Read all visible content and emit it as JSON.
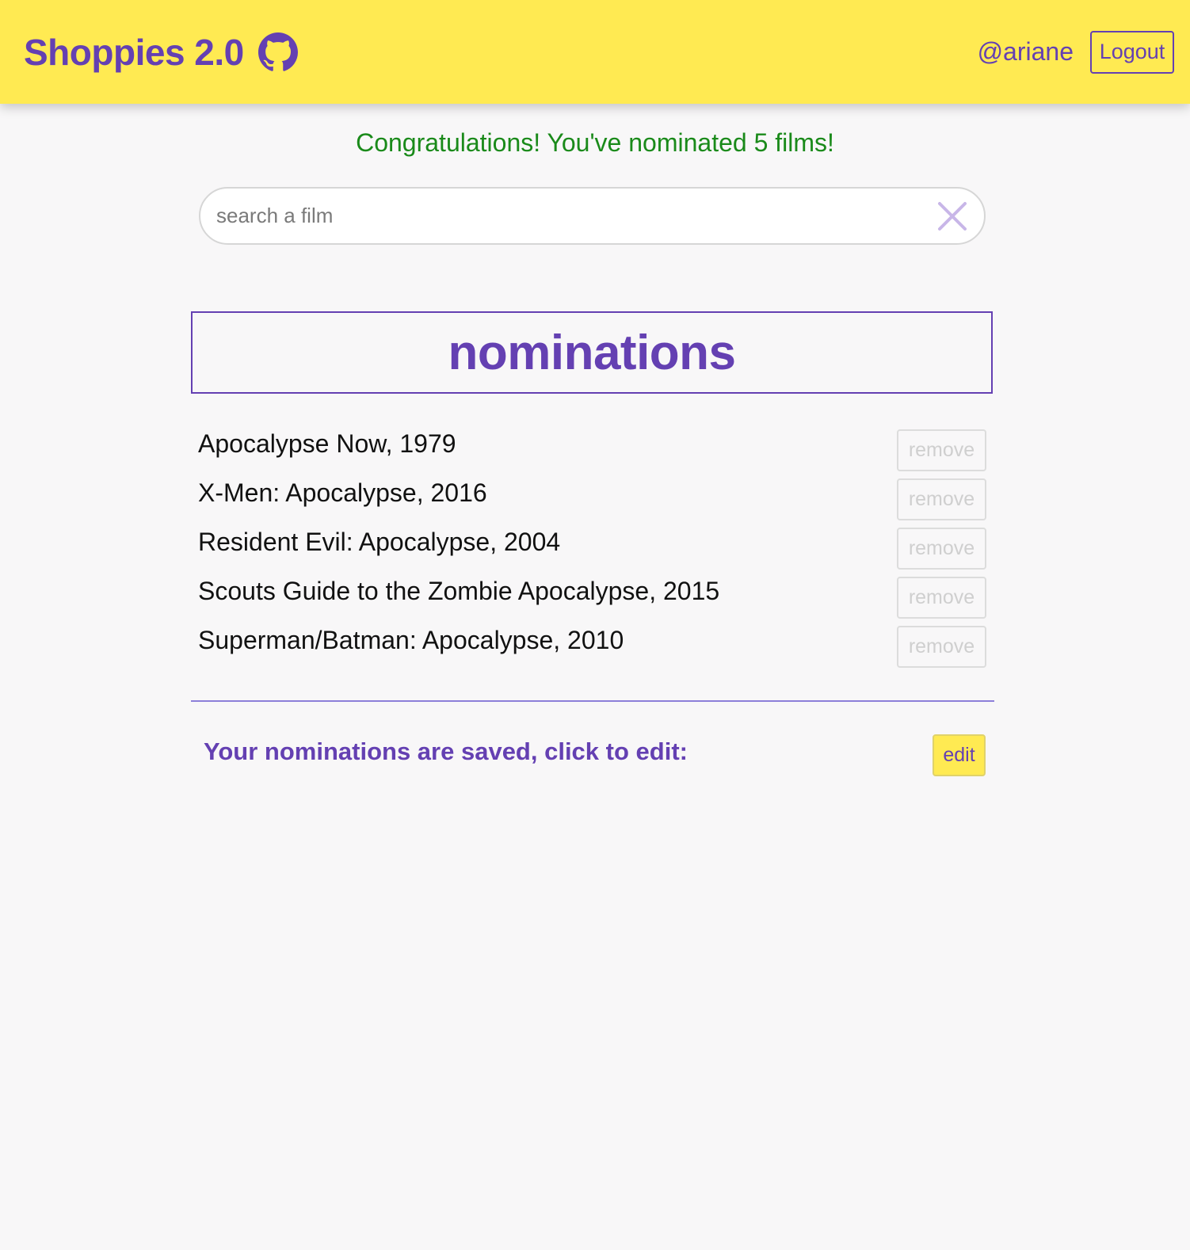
{
  "header": {
    "title": "Shoppies 2.0",
    "github_icon": "github-icon",
    "username": "@ariane",
    "logout_label": "Logout"
  },
  "banner": {
    "message": "Congratulations! You've nominated 5 films!"
  },
  "search": {
    "placeholder": "search a film",
    "value": "",
    "clear_icon": "close-icon"
  },
  "nominations": {
    "title": "nominations",
    "items": [
      {
        "title": "Apocalypse Now, 1979",
        "remove_label": "remove"
      },
      {
        "title": "X-Men: Apocalypse, 2016",
        "remove_label": "remove"
      },
      {
        "title": "Resident Evil: Apocalypse, 2004",
        "remove_label": "remove"
      },
      {
        "title": "Scouts Guide to the Zombie Apocalypse, 2015",
        "remove_label": "remove"
      },
      {
        "title": "Superman/Batman: Apocalypse, 2010",
        "remove_label": "remove"
      }
    ],
    "saved_message": "Your nominations are saved, click to edit:",
    "edit_label": "edit"
  },
  "colors": {
    "header_bg": "#ffea52",
    "brand_purple": "#6440b2",
    "success_green": "#1a8a1a",
    "page_bg": "#f8f7f8"
  }
}
